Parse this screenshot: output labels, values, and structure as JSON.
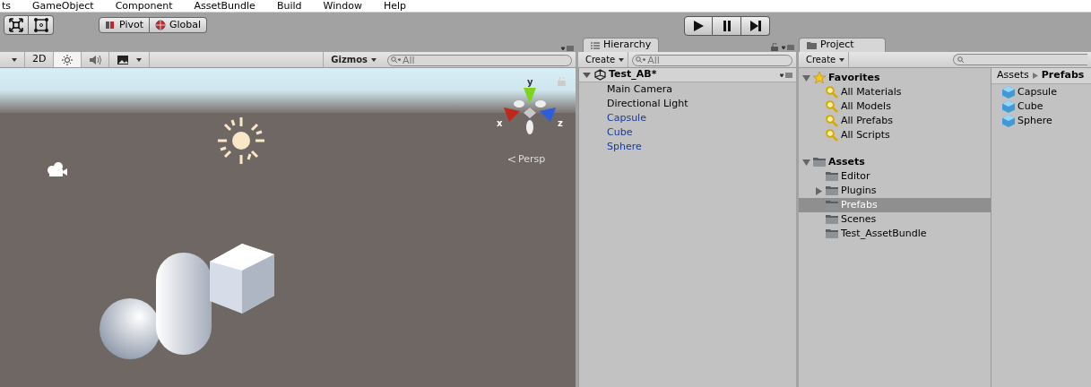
{
  "menu_bar": [
    "ts",
    "GameObject",
    "Component",
    "AssetBundle",
    "Build",
    "Window",
    "Help"
  ],
  "toolbar": {
    "tools": [
      {
        "kind": "move-arrows",
        "selected": false
      },
      {
        "kind": "rect",
        "selected": false
      }
    ],
    "pivot": [
      {
        "label": "Pivot",
        "kind": "pivot"
      },
      {
        "label": "Global",
        "kind": "global"
      }
    ],
    "playback": [
      {
        "kind": "play",
        "selected": false
      },
      {
        "kind": "pause",
        "selected": false
      },
      {
        "kind": "step",
        "selected": false
      }
    ]
  },
  "scene": {
    "toolbar": [
      {
        "kind": "dropdown",
        "selected": false
      },
      {
        "kind": "text",
        "label": "2D",
        "selected": false
      },
      {
        "kind": "sun",
        "selected": true
      },
      {
        "kind": "audio",
        "selected": false
      },
      {
        "kind": "image",
        "selected": false
      }
    ],
    "gizmos": "Gizmos",
    "search_placeholder": "All",
    "axes": [
      "y",
      "x",
      "z"
    ],
    "projection": "Persp"
  },
  "hierarchy": {
    "title": "Hierarchy",
    "create": "Create",
    "search_placeholder": "All",
    "scene": "Test_AB*",
    "items": [
      {
        "label": "Main Camera",
        "prefab": false
      },
      {
        "label": "Directional Light",
        "prefab": false
      },
      {
        "label": "Capsule",
        "prefab": true
      },
      {
        "label": "Cube",
        "prefab": true
      },
      {
        "label": "Sphere",
        "prefab": true
      }
    ]
  },
  "project": {
    "title": "Project",
    "create": "Create",
    "tree": [
      {
        "label": "Favorites",
        "kind": "star",
        "expanded": true,
        "children": [
          {
            "label": "All Materials",
            "kind": "search"
          },
          {
            "label": "All Models",
            "kind": "search"
          },
          {
            "label": "All Prefabs",
            "kind": "search"
          },
          {
            "label": "All Scripts",
            "kind": "search"
          }
        ]
      },
      {
        "label": "Assets",
        "kind": "folder",
        "expanded": true,
        "children": [
          {
            "label": "Editor",
            "kind": "folder",
            "selected": false
          },
          {
            "label": "Plugins",
            "kind": "folder",
            "selected": false,
            "expandable": true,
            "expanded": false
          },
          {
            "label": "Prefabs",
            "kind": "folder",
            "selected": true
          },
          {
            "label": "Scenes",
            "kind": "folder",
            "selected": false
          },
          {
            "label": "Test_AssetBundle",
            "kind": "folder",
            "selected": false
          }
        ]
      }
    ],
    "breadcrumb": [
      "Assets",
      "Prefabs"
    ],
    "assets": [
      "Capsule",
      "Cube",
      "Sphere"
    ]
  }
}
